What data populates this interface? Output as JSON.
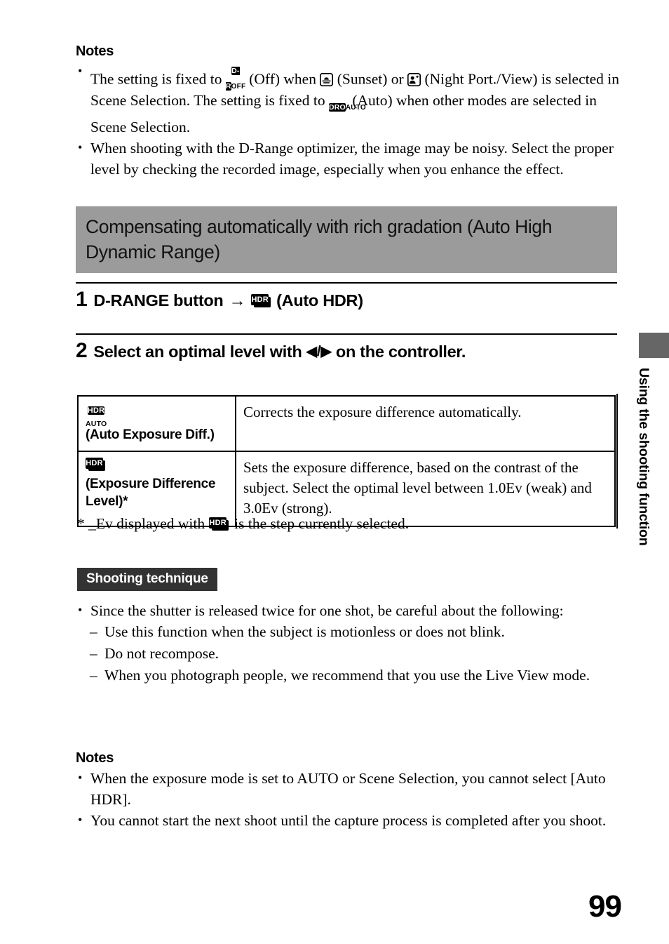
{
  "page": {
    "number": "99",
    "side_tab_label": "Using the shooting function",
    "side_tab_color": "#666666",
    "banner_color": "#9b9b9b",
    "badge_color": "#333333"
  },
  "notes_top": {
    "heading": "Notes",
    "items": [
      {
        "parts": [
          {
            "type": "text",
            "value": "The setting is fixed to "
          },
          {
            "type": "icon",
            "name": "d-range-off-icon",
            "top": "D-R",
            "bottom": "OFF"
          },
          {
            "type": "text",
            "value": " (Off) when "
          },
          {
            "type": "icon",
            "name": "sunset-icon"
          },
          {
            "type": "text",
            "value": " (Sunset) or "
          },
          {
            "type": "icon",
            "name": "night-portrait-view-icon"
          },
          {
            "type": "text",
            "value": " (Night Port./View) is selected in Scene Selection. The setting is fixed to "
          },
          {
            "type": "icon",
            "name": "dro-auto-icon",
            "top": "DRO",
            "bottom": "AUTO"
          },
          {
            "type": "text",
            "value": " (Auto) when other modes are selected in Scene Selection."
          }
        ]
      },
      {
        "parts": [
          {
            "type": "text",
            "value": "When shooting with the D-Range optimizer, the image may be noisy. Select the proper level by checking the recorded image, especially when you enhance the effect."
          }
        ]
      }
    ]
  },
  "section": {
    "title": "Compensating automatically with rich gradation (Auto High Dynamic Range)"
  },
  "steps": [
    {
      "number": "1",
      "before": "D-RANGE button",
      "arrow": "→",
      "icon": {
        "name": "auto-hdr-icon",
        "label": "HDR"
      },
      "after": "(Auto HDR)"
    },
    {
      "number": "2",
      "before": "Select an optimal level with",
      "glyph": "◀/▶",
      "after": "on the controller."
    }
  ],
  "table": {
    "rows": [
      {
        "icon": {
          "name": "hdr-auto-icon",
          "top": "HDR",
          "bottom": "AUTO"
        },
        "label": "(Auto Exposure Diff.)",
        "description": "Corrects the exposure difference automatically."
      },
      {
        "icon": {
          "name": "hdr-level-icon",
          "label": "HDR"
        },
        "label": "(Exposure Difference Level)*",
        "description": "Sets the exposure difference, based on the contrast of the subject. Select the optimal level between 1.0Ev (weak) and 3.0Ev (strong)."
      }
    ]
  },
  "footnote": {
    "before": "* _Ev displayed with",
    "icon": {
      "name": "hdr-level-icon",
      "label": "HDR"
    },
    "after": "is the step currently selected."
  },
  "shooting_technique": {
    "badge": "Shooting technique",
    "bullet": "Since the shutter is released twice for one shot, be careful about the following:",
    "sub_items": [
      "Use this function when the subject is motionless or does not blink.",
      "Do not recompose.",
      "When you photograph people, we recommend that you use the Live View mode."
    ]
  },
  "notes_bottom": {
    "heading": "Notes",
    "items": [
      "When the exposure mode is set to AUTO or Scene Selection, you cannot select [Auto HDR].",
      "You cannot start the next shoot until the capture process is completed after you shoot."
    ]
  }
}
